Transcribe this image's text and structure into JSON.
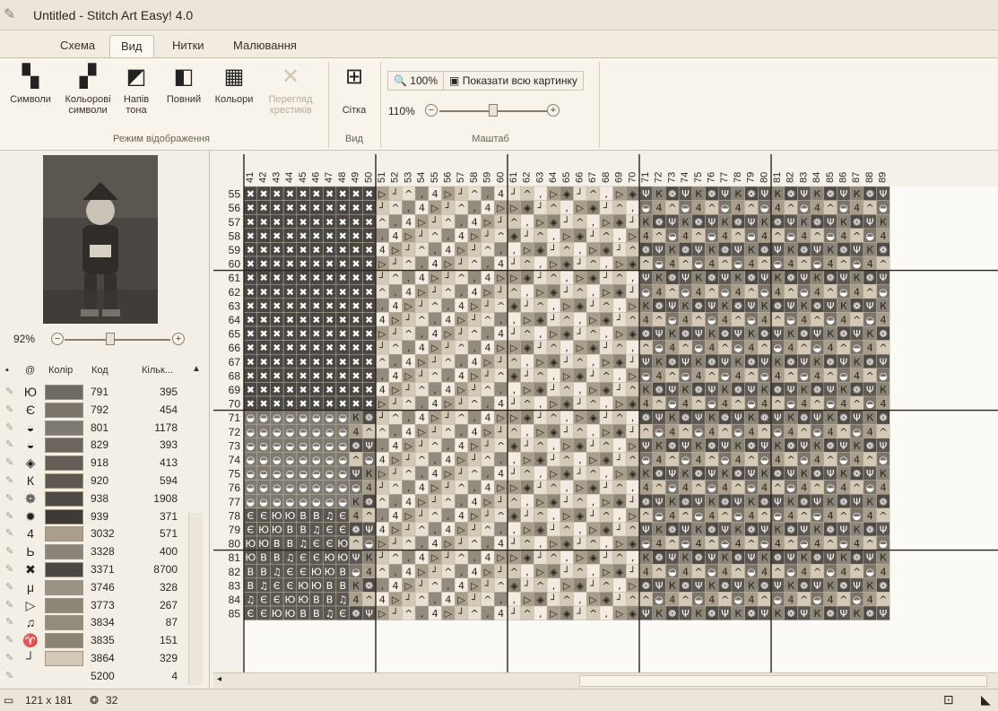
{
  "window": {
    "title": "Untitled - Stitch Art Easy! 4.0"
  },
  "tabs": [
    {
      "label": "Схема"
    },
    {
      "label": "Вид"
    },
    {
      "label": "Нитки"
    },
    {
      "label": "Малювання"
    }
  ],
  "ribbon": {
    "display_buttons": [
      {
        "label1": "Символи",
        "label2": "",
        "icon": "symbols-icon",
        "enabled": true
      },
      {
        "label1": "Кольорові",
        "label2": "символи",
        "icon": "color-symbols-icon",
        "enabled": true
      },
      {
        "label1": "Напів",
        "label2": "тона",
        "icon": "halftone-icon",
        "enabled": true
      },
      {
        "label1": "Повний",
        "label2": "",
        "icon": "full-icon",
        "enabled": true
      },
      {
        "label1": "Кольори",
        "label2": "",
        "icon": "colors-icon",
        "enabled": true
      },
      {
        "label1": "Перегляд",
        "label2": "хрестиків",
        "icon": "cross-preview-icon",
        "enabled": false
      }
    ],
    "display_group_label": "Режим відображення",
    "grid_button": "Сітка",
    "view_group_label": "Вид",
    "zoom_100": "100%",
    "show_all": "Показати всю картинку",
    "zoom_level": "110%",
    "zoom_group_label": "Маштаб"
  },
  "preview": {
    "zoom": "92%"
  },
  "legend": {
    "headers": {
      "at": "@",
      "color": "Колір",
      "code": "Код",
      "count": "Кільк..."
    },
    "rows": [
      {
        "sym": "Ю",
        "color": "#6f6a63",
        "code": "791",
        "count": "395"
      },
      {
        "sym": "Є",
        "color": "#7a746b",
        "code": "792",
        "count": "454"
      },
      {
        "sym": "◒",
        "color": "#7f7a71",
        "code": "801",
        "count": "1178"
      },
      {
        "sym": "◒",
        "color": "#6a655e",
        "code": "829",
        "count": "393"
      },
      {
        "sym": "◈",
        "color": "#625d56",
        "code": "918",
        "count": "413"
      },
      {
        "sym": "К",
        "color": "#5c5751",
        "code": "920",
        "count": "594"
      },
      {
        "sym": "❁",
        "color": "#4f4a45",
        "code": "938",
        "count": "1908"
      },
      {
        "sym": "✹",
        "color": "#3e3a36",
        "code": "939",
        "count": "371"
      },
      {
        "sym": "4",
        "color": "#a99d8b",
        "code": "3032",
        "count": "571"
      },
      {
        "sym": "Ь",
        "color": "#8b8479",
        "code": "3328",
        "count": "400"
      },
      {
        "sym": "✖",
        "color": "#4a4642",
        "code": "3371",
        "count": "8700"
      },
      {
        "sym": "μ",
        "color": "#9a9284",
        "code": "3746",
        "count": "328"
      },
      {
        "sym": "▷",
        "color": "#8e8778",
        "code": "3773",
        "count": "267"
      },
      {
        "sym": "♫",
        "color": "#938b7d",
        "code": "3834",
        "count": "87"
      },
      {
        "sym": "♈",
        "color": "#8a8376",
        "code": "3835",
        "count": "151"
      },
      {
        "sym": "┘",
        "color": "#d4c9b6",
        "code": "3864",
        "count": "329"
      },
      {
        "sym": "",
        "color": "",
        "code": "5200",
        "count": "4"
      }
    ]
  },
  "grid": {
    "col_start": 41,
    "col_end": 89,
    "row_start": 55,
    "row_end": 85
  },
  "status": {
    "size": "121 x 181",
    "colors": "32"
  }
}
